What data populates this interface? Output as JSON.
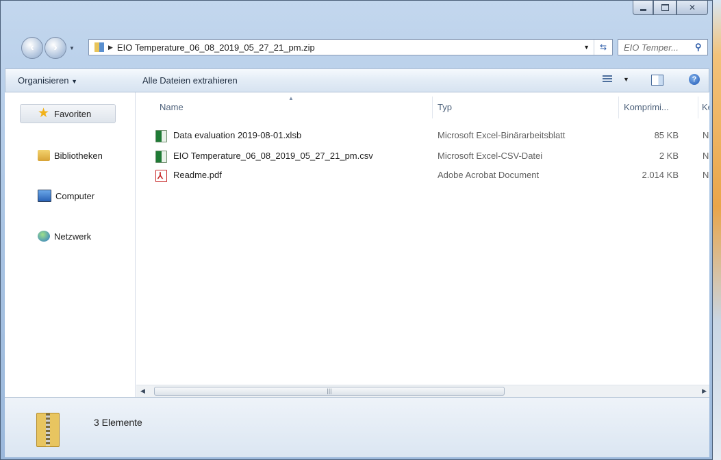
{
  "window": {
    "address_path": "EIO Temperature_06_08_2019_05_27_21_pm.zip",
    "search_placeholder": "EIO Temper...",
    "caption": {
      "min": "—",
      "max": "□",
      "close": "✕"
    }
  },
  "commands": {
    "organize": "Organisieren",
    "extract_all": "Alle Dateien extrahieren"
  },
  "nav": {
    "favorites": "Favoriten",
    "libraries": "Bibliotheken",
    "computer": "Computer",
    "network": "Netzwerk"
  },
  "columns": {
    "name": "Name",
    "type": "Typ",
    "compressed": "Komprimi...",
    "protected": "Ken"
  },
  "files": [
    {
      "name": "Data evaluation 2019-08-01.xlsb",
      "type": "Microsoft Excel-Binärarbeitsblatt",
      "size": "85 KB",
      "protected": "Nei",
      "icon": "excel-icon"
    },
    {
      "name": "EIO Temperature_06_08_2019_05_27_21_pm.csv",
      "type": "Microsoft Excel-CSV-Datei",
      "size": "2 KB",
      "protected": "Nei",
      "icon": "excel-icon"
    },
    {
      "name": "Readme.pdf",
      "type": "Adobe Acrobat Document",
      "size": "2.014 KB",
      "protected": "Nei",
      "icon": "pdf-icon"
    }
  ],
  "status": {
    "count_text": "3 Elemente"
  }
}
